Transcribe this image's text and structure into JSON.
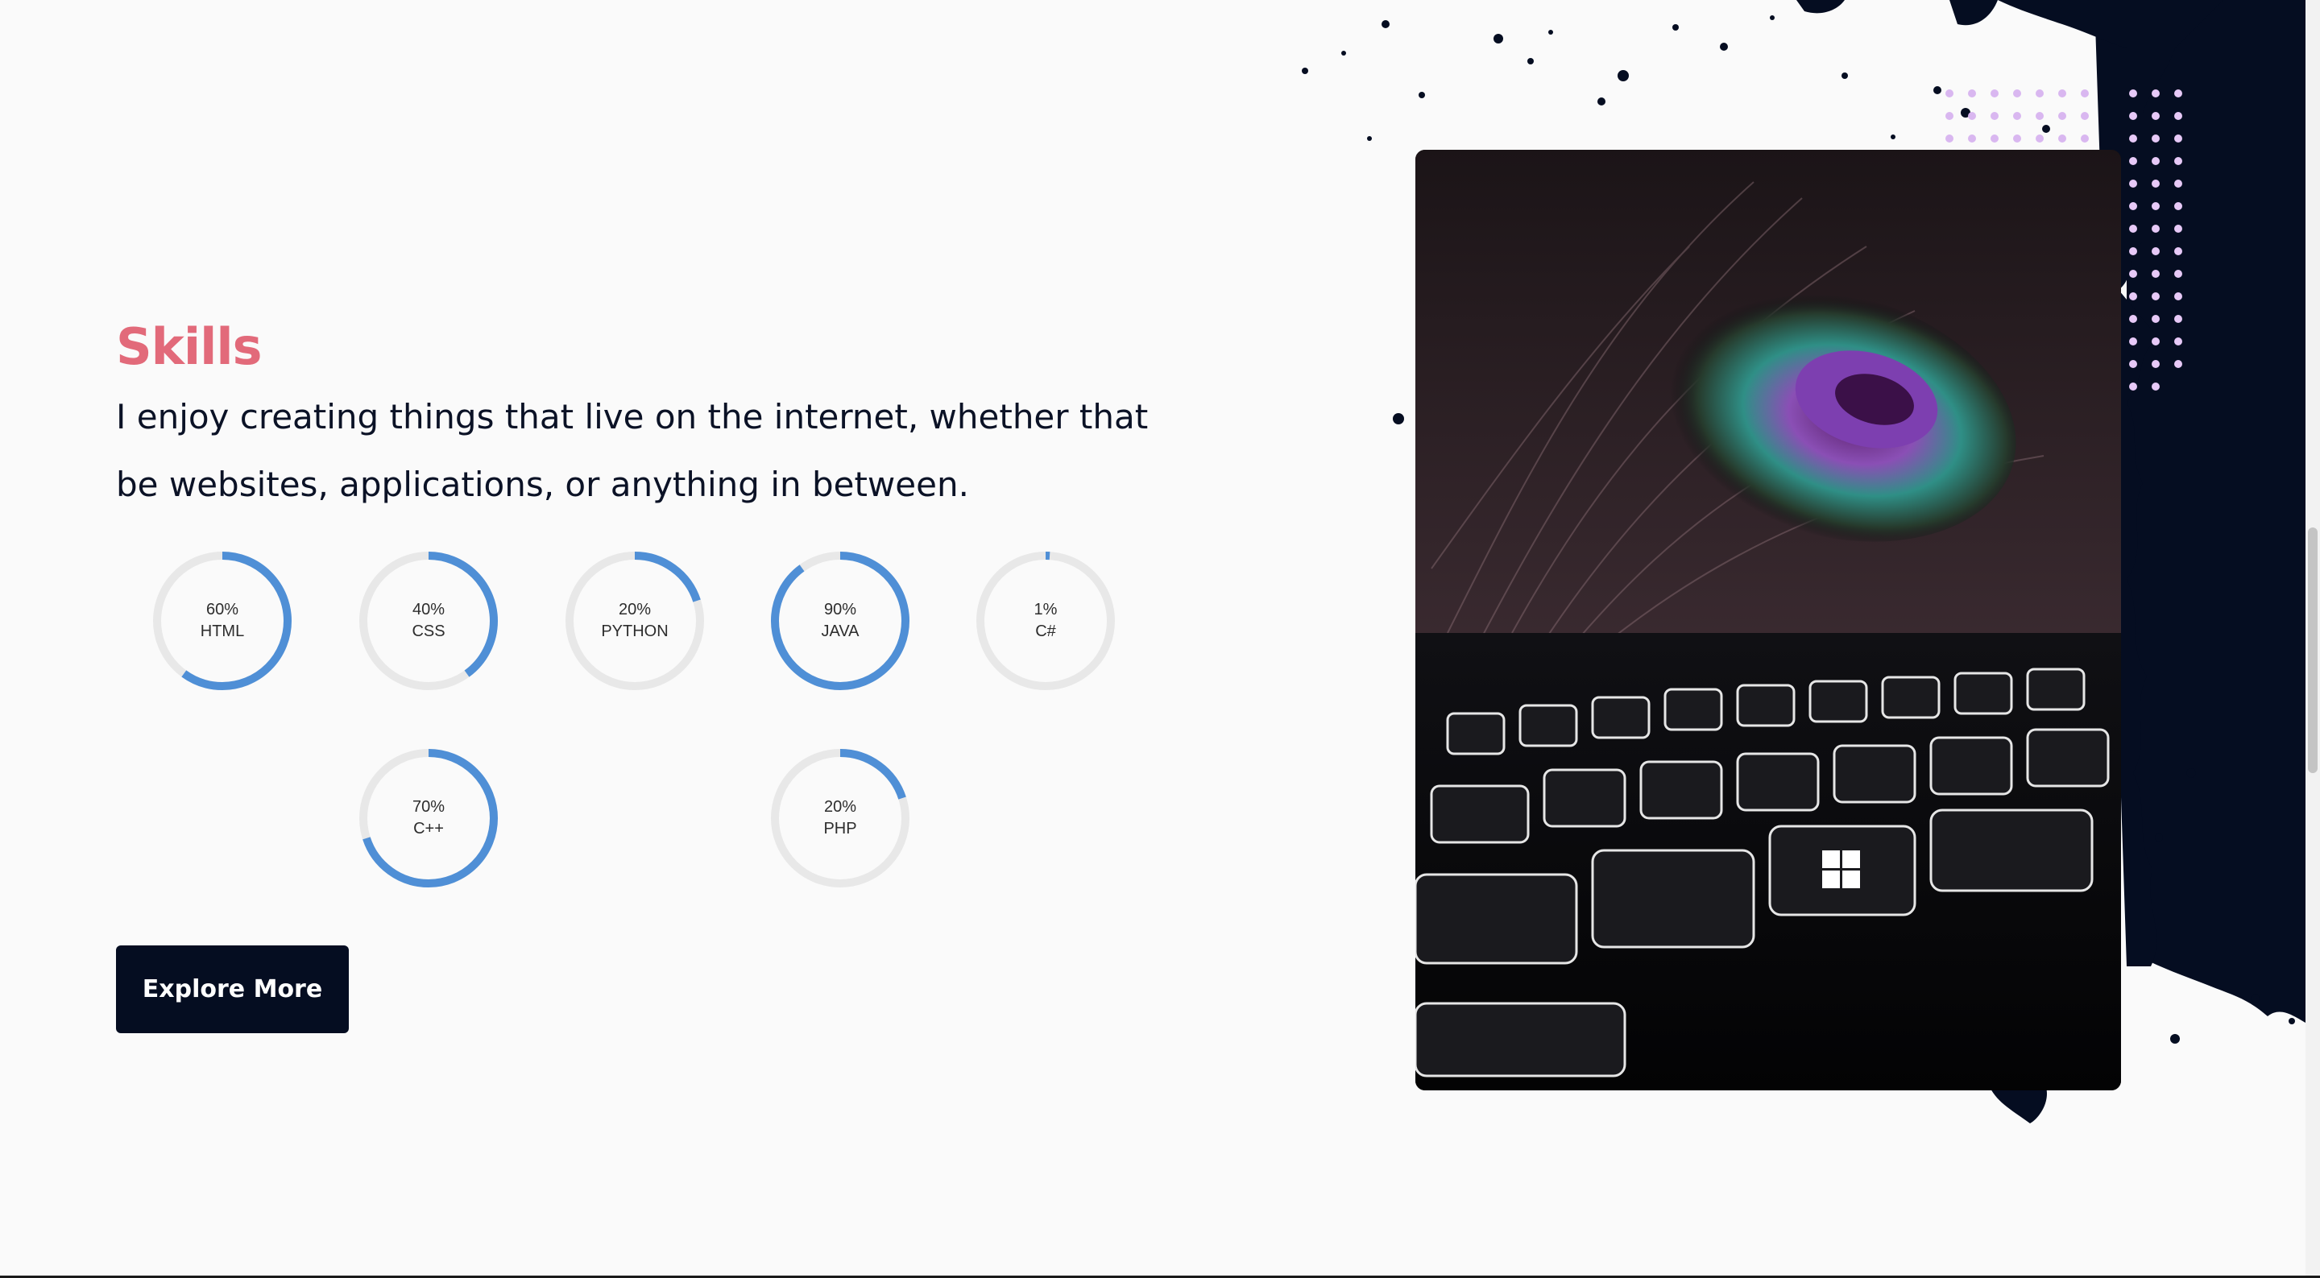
{
  "section": {
    "heading": "Skills",
    "intro": "I enjoy creating things that live on the internet, whether that be websites, applications, or anything in between."
  },
  "skills": [
    {
      "percent": 60,
      "percent_label": "60%",
      "name": "HTML"
    },
    {
      "percent": 40,
      "percent_label": "40%",
      "name": "CSS"
    },
    {
      "percent": 20,
      "percent_label": "20%",
      "name": "PYTHON"
    },
    {
      "percent": 90,
      "percent_label": "90%",
      "name": "JAVA"
    },
    {
      "percent": 1,
      "percent_label": "1%",
      "name": "C#"
    },
    {
      "percent": 70,
      "percent_label": "70%",
      "name": "C++"
    },
    {
      "percent": 20,
      "percent_label": "20%",
      "name": "PHP"
    }
  ],
  "button": {
    "label": "Explore More"
  },
  "colors": {
    "accent": "#e26a7a",
    "ring_fill": "#4f8fd6",
    "ring_track": "#e8e8e8",
    "navy": "#050d21"
  },
  "image": {
    "icon": "laptop-keyboard-photo"
  }
}
